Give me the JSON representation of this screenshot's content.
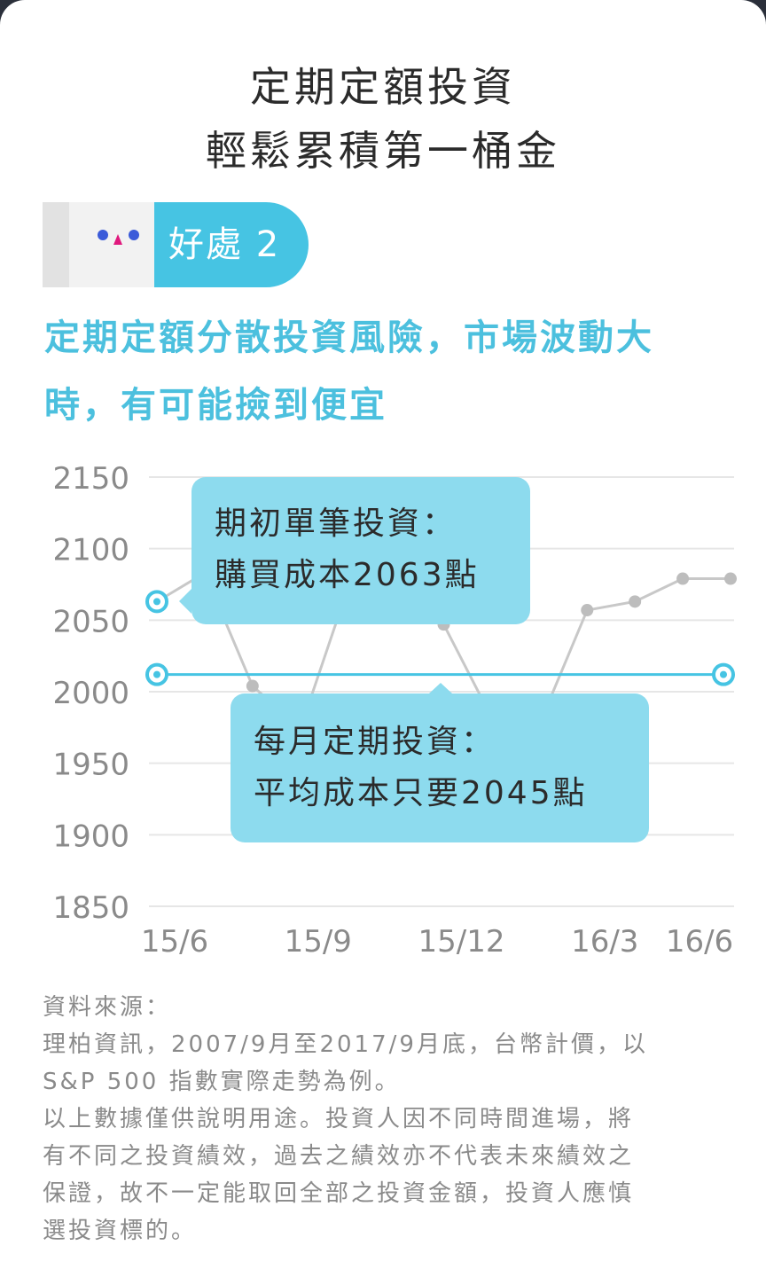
{
  "header": {
    "title_line1": "定期定額投資",
    "title_line2": "輕鬆累積第一桶金"
  },
  "tag": {
    "label": "好處 2"
  },
  "subtitle": {
    "line1": "定期定額分散投資風險，市場波動大",
    "line2": "時，有可能撿到便宜"
  },
  "chart_data": {
    "type": "line",
    "title": "",
    "xlabel": "",
    "ylabel": "",
    "ylim": [
      1850,
      2150
    ],
    "yticks": [
      2150,
      2100,
      2050,
      2000,
      1950,
      1900,
      1850
    ],
    "xticks": [
      "15/6",
      "15/9",
      "15/12",
      "16/3",
      "16/6"
    ],
    "grid": true,
    "series": [
      {
        "values": [
          2063,
          2083,
          2004,
          1974,
          2073,
          2072,
          2047,
          1982,
          1977,
          2057,
          2063,
          2079,
          2079
        ],
        "color": "#c8c8c8"
      }
    ],
    "reference_lines": [
      {
        "y": 2063,
        "style": "endpoint-marker",
        "color": "#46c4e3"
      },
      {
        "y": 2012,
        "style": "horizontal-line",
        "color": "#46c4e3"
      }
    ],
    "annotations": [
      {
        "line1": "期初單筆投資：",
        "line2": "購買成本2063點"
      },
      {
        "line1": "每月定期投資：",
        "line2": "平均成本只要2045點"
      }
    ]
  },
  "notes": {
    "lines": [
      "資料來源：",
      "理柏資訊，2007/9月至2017/9月底，台幣計價，以",
      "S&P 500 指數實際走勢為例。",
      "以上數據僅供說明用途。投資人因不同時間進場，將",
      "有不同之投資績效，過去之績效亦不代表未來績效之",
      "保證，故不一定能取回全部之投資金額，投資人應慎",
      "選投資標的。"
    ]
  },
  "colors": {
    "accent": "#46c4e3",
    "callout": "#8ddbee",
    "series": "#c8c8c8",
    "face_blue": "#3b5bd9",
    "face_pink": "#e0197d"
  }
}
